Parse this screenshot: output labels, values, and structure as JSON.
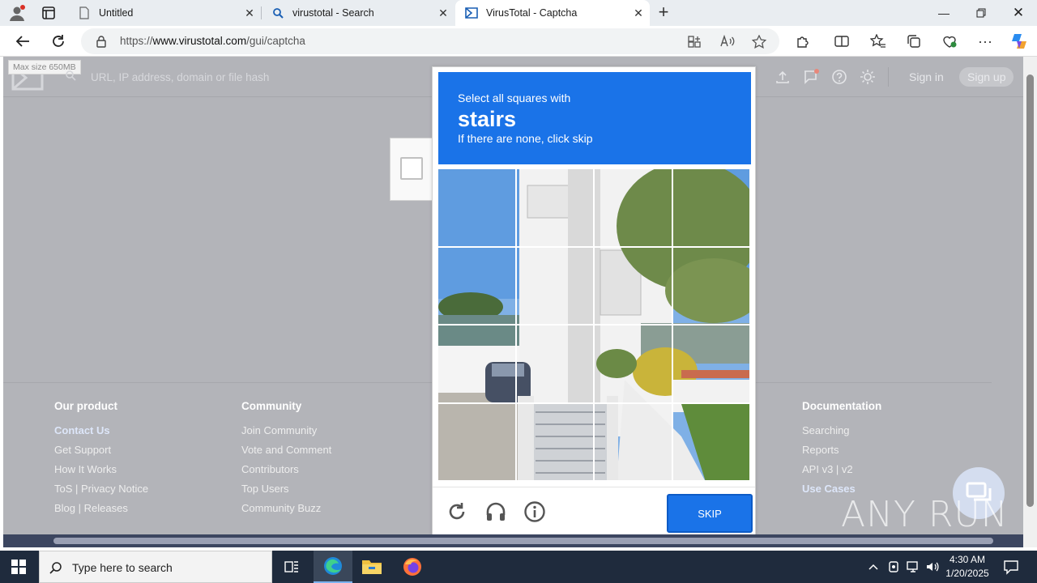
{
  "browser": {
    "tabs": [
      {
        "title": "Untitled",
        "icon": "document-icon"
      },
      {
        "title": "virustotal - Search",
        "icon": "search-icon"
      },
      {
        "title": "VirusTotal - Captcha",
        "icon": "virustotal-icon"
      }
    ],
    "url_prefix": "https://",
    "url_host": "www.virustotal.com",
    "url_path": "/gui/captcha"
  },
  "vt": {
    "max_size": "Max size 650MB",
    "search_placeholder": "URL, IP address, domain or file hash",
    "sign_in": "Sign in",
    "sign_up": "Sign up"
  },
  "captcha": {
    "instruction": "Select all squares with",
    "target": "stairs",
    "hint": "If there are none, click skip",
    "skip": "SKIP"
  },
  "footer": {
    "col1": {
      "title": "Our product",
      "items": [
        "Contact Us",
        "Get Support",
        "How It Works",
        "ToS | Privacy Notice",
        "Blog | Releases"
      ]
    },
    "col2": {
      "title": "Community",
      "items": [
        "Join Community",
        "Vote and Comment",
        "Contributors",
        "Top Users",
        "Community Buzz"
      ]
    },
    "col3": {
      "title": "Documentation",
      "items": [
        "Searching",
        "Reports",
        "API v3 | v2",
        "Use Cases"
      ]
    }
  },
  "watermark": "ANY RUN",
  "taskbar": {
    "search_placeholder": "Type here to search",
    "time": "4:30 AM",
    "date": "1/20/2025"
  },
  "colors": {
    "accent": "#1a73e8",
    "taskbar": "#1f2b3d",
    "overlay": "#b3b4b9"
  }
}
